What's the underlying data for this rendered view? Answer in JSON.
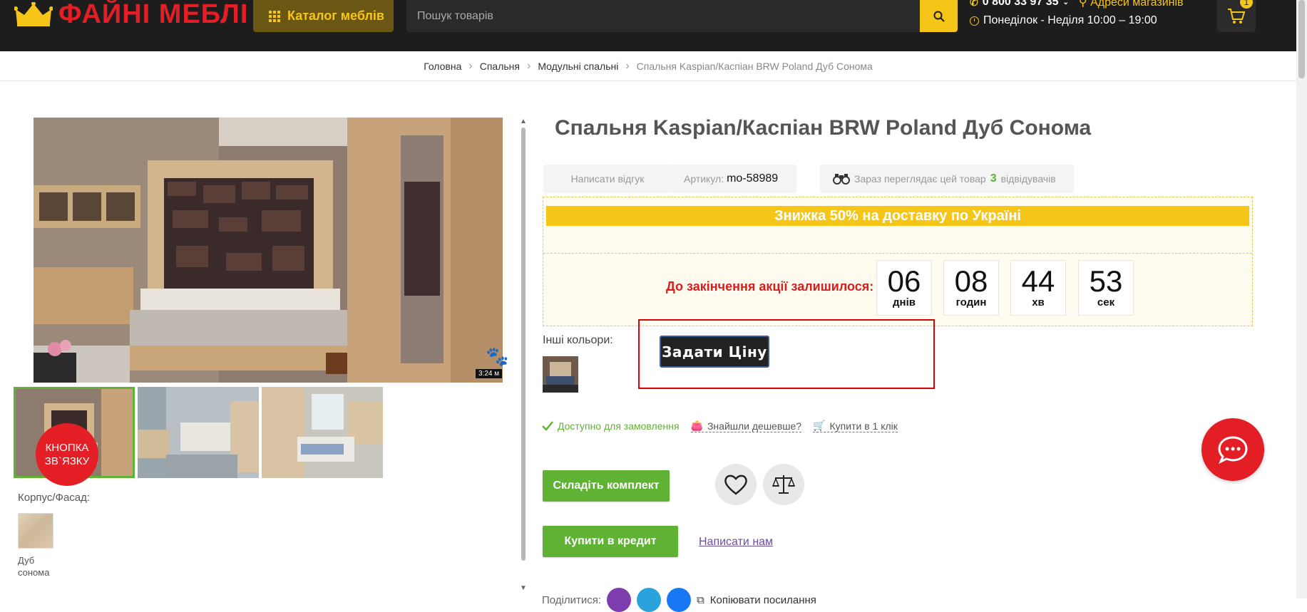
{
  "header": {
    "logo_text": "ФАЙНІ МЕБЛІ",
    "catalog_label": "Каталог меблів",
    "search_placeholder": "Пошук товарів",
    "phone": "0 800 33 97 35",
    "stores_label": "Адреси магазинів",
    "hours": "Понеділок - Неділя 10:00 – 19:00",
    "cart_count": "1"
  },
  "breadcrumb": [
    "Головна",
    "Спальня",
    "Модульні спальні",
    "Спальня Kaspian/Каспіан BRW Poland Дуб Сонома"
  ],
  "gallery": {
    "photo_time": "3:24 м",
    "contact_button": "КНОПКА ЗВ`ЯЗКУ",
    "korpus_label": "Корпус/Фасад:",
    "swatch_name": "Дуб сонома"
  },
  "product": {
    "title": "Спальня Kaspian/Каспіан BRW Poland Дуб Сонома",
    "write_review": "Написати відгук",
    "sku_label": "Артикул:",
    "sku_value": "mo-58989",
    "viewers_prefix": "Зараз переглядає цей товар",
    "viewers_count": "3",
    "viewers_suffix": "відвідувачів"
  },
  "promo": {
    "banner": "Знижка 50% на доставку по Україні",
    "countdown_label": "До закінчення акції залишилося:",
    "countdown": [
      {
        "value": "06",
        "unit": "днів"
      },
      {
        "value": "08",
        "unit": "годин"
      },
      {
        "value": "44",
        "unit": "хв"
      },
      {
        "value": "53",
        "unit": "сек"
      }
    ]
  },
  "other_colors_label": "Інші кольори:",
  "ask_price_label": "Задати Ціну",
  "availability": {
    "available": "Доступно для замовлення",
    "cheaper": "Знайшли дешевше?",
    "one_click": "Купити в 1 клік"
  },
  "actions": {
    "kit_label": "Складіть комплект",
    "credit_label": "Купити в кредит",
    "write_us": "Написати нам"
  },
  "share": {
    "label": "Поділитися:",
    "copy_link": "Копіювати посилання"
  },
  "colors": {
    "header_bg": "#1d1d1d",
    "brand_red": "#e41e25",
    "accent_yellow": "#f5c518",
    "green": "#5fb233"
  }
}
